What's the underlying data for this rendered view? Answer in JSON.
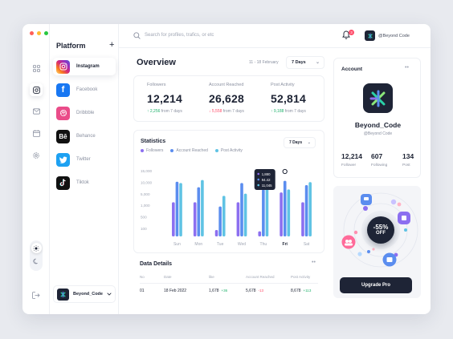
{
  "window": {
    "traffic_colors": [
      "#ff5f57",
      "#febc2e",
      "#28c840"
    ]
  },
  "rail": {
    "icons": [
      "grid-icon",
      "instagram-icon",
      "mail-icon",
      "calendar-icon",
      "settings-icon",
      "logout-icon"
    ],
    "theme": [
      "sun-icon",
      "moon-icon"
    ]
  },
  "platform": {
    "title": "Platform",
    "add": "+",
    "items": [
      {
        "label": "Instagram",
        "active": true,
        "color": "#e4405f"
      },
      {
        "label": "Facebook",
        "active": false,
        "color": "#1877f2"
      },
      {
        "label": "Dribbble",
        "active": false,
        "color": "#ea4c89"
      },
      {
        "label": "Behance",
        "active": false,
        "color": "#111111"
      },
      {
        "label": "Twitter",
        "active": false,
        "color": "#1da1f2"
      },
      {
        "label": "Tiktok",
        "active": false,
        "color": "#111111"
      }
    ],
    "profile_name": "Beyond_Code"
  },
  "topbar": {
    "search_placeholder": "Search for profiles, trafics, or etc",
    "notifications": "3",
    "user": "@Beyond Code"
  },
  "overview": {
    "title": "Overview",
    "date_range": "11 - 18 February",
    "days": "7 Days"
  },
  "stats": [
    {
      "label": "Followers",
      "value": "12,214",
      "delta": "2,256",
      "direction": "up",
      "suffix": "from 7 days"
    },
    {
      "label": "Account Reached",
      "value": "26,628",
      "delta": "5,558",
      "direction": "down",
      "suffix": "from 7 days"
    },
    {
      "label": "Post Activity",
      "value": "52,814",
      "delta": "9,188",
      "direction": "up",
      "suffix": "from 7 days"
    }
  ],
  "statistics": {
    "title": "Statistics",
    "days": "7 Days"
  },
  "chart_data": {
    "type": "bar",
    "categories": [
      "Sun",
      "Mon",
      "Tue",
      "Wed",
      "Thu",
      "Fri",
      "Sat"
    ],
    "series": [
      {
        "name": "Followers",
        "color": "#8c6ff0",
        "values": [
          8000,
          8000,
          1500,
          8000,
          1200,
          10300,
          8000
        ]
      },
      {
        "name": "Account Reached",
        "color": "#5b8def",
        "values": [
          12800,
          11500,
          7000,
          12500,
          11000,
          13000,
          12000
        ]
      },
      {
        "name": "Post Activity",
        "color": "#5fc3e4",
        "values": [
          12500,
          13200,
          9500,
          10000,
          13500,
          11000,
          12700
        ]
      }
    ],
    "yticks": [
      "15,000",
      "10,000",
      "5,000",
      "1,000",
      "500",
      "100"
    ],
    "ylim": [
      0,
      15000
    ],
    "highlight": "Fri",
    "tooltip": [
      "1,880",
      "94.42",
      "11,045"
    ]
  },
  "details": {
    "title": "Data Details",
    "more": "••",
    "headers": [
      "No",
      "Date",
      "like",
      "Account Reached",
      "Post Activity"
    ],
    "rows": [
      {
        "no": "01",
        "date": "18 Feb 2022",
        "like": "1,678",
        "like_delta": "+36",
        "reached": "5,678",
        "reached_delta": "-13",
        "activity": "8,678",
        "activity_delta": "+113"
      }
    ]
  },
  "account": {
    "title": "Account",
    "more": "••",
    "name": "Beyond_Code",
    "handle": "@Beyond Code",
    "stats": [
      {
        "value": "12,214",
        "label": "Follower"
      },
      {
        "value": "607",
        "label": "Following"
      },
      {
        "value": "134",
        "label": "Post"
      }
    ]
  },
  "promo": {
    "percent": "-55%",
    "off": "OFF",
    "button": "Upgrade Pro"
  }
}
